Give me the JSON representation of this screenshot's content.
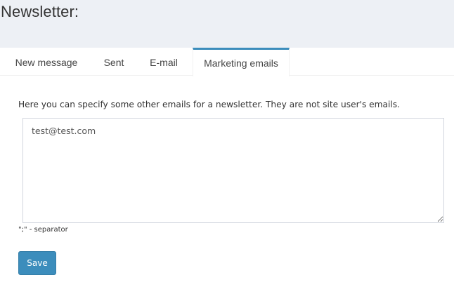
{
  "header": {
    "title": "Newsletter:"
  },
  "tabs": [
    {
      "label": "New message",
      "active": false
    },
    {
      "label": "Sent",
      "active": false
    },
    {
      "label": "E-mail",
      "active": false
    },
    {
      "label": "Marketing emails",
      "active": true
    }
  ],
  "main": {
    "description": "Here you can specify some other emails for a newsletter. They are not site user's emails.",
    "emails_value": "test@test.com",
    "help_text": "\";\" - separator",
    "save_label": "Save"
  },
  "colors": {
    "header_bg": "#edf0f5",
    "accent": "#3c8dbc"
  }
}
